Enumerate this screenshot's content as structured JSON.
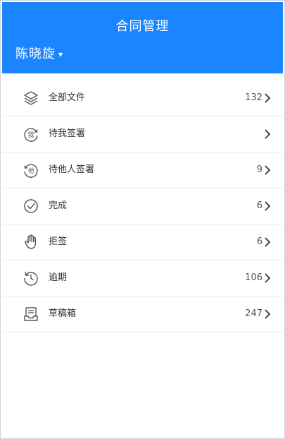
{
  "header": {
    "title": "合同管理",
    "user_name": "陈晓旋",
    "user_caret": "▾",
    "bg_color": "#1a85ff"
  },
  "menu": [
    {
      "label": "全部文件",
      "count": "132",
      "icon": "layers-icon"
    },
    {
      "label": "待我签署",
      "count": "",
      "icon": "me-sign-icon"
    },
    {
      "label": "待他人签署",
      "count": "9",
      "icon": "others-sign-icon"
    },
    {
      "label": "完成",
      "count": "6",
      "icon": "check-circle-icon"
    },
    {
      "label": "拒签",
      "count": "6",
      "icon": "hand-icon"
    },
    {
      "label": "逾期",
      "count": "106",
      "icon": "history-icon"
    },
    {
      "label": "草稿箱",
      "count": "247",
      "icon": "drafts-icon"
    }
  ]
}
